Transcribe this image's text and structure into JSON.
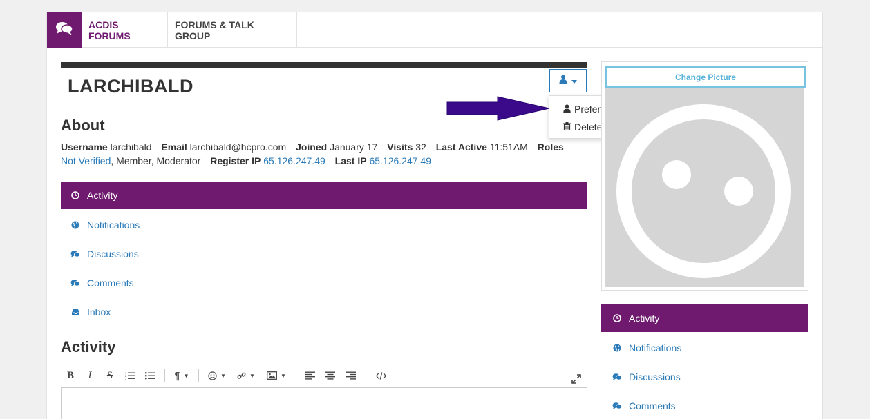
{
  "topnav": {
    "tabs": [
      {
        "label": "ACDIS FORUMS"
      },
      {
        "label": "FORUMS & TALK GROUP"
      }
    ]
  },
  "profile": {
    "username": "LARCHIBALD",
    "menu": {
      "items": [
        {
          "label": "Preferences",
          "icon": "user-icon"
        },
        {
          "label": "Delete Content",
          "icon": "trash-icon"
        }
      ]
    }
  },
  "about": {
    "heading": "About",
    "username_label": "Username",
    "username_value": "larchibald",
    "email_label": "Email",
    "email_value": "larchibald@hcpro.com",
    "joined_label": "Joined",
    "joined_value": "January 17",
    "visits_label": "Visits",
    "visits_value": "32",
    "last_active_label": "Last Active",
    "last_active_value": "11:51AM",
    "roles_label": "Roles",
    "roles_link": "Not Verified",
    "roles_rest": ", Member, Moderator",
    "register_ip_label": "Register IP",
    "register_ip_value": "65.126.247.49",
    "last_ip_label": "Last IP",
    "last_ip_value": "65.126.247.49"
  },
  "tabs": [
    {
      "label": "Activity",
      "icon": "clock-icon",
      "active": true
    },
    {
      "label": "Notifications",
      "icon": "globe-icon"
    },
    {
      "label": "Discussions",
      "icon": "comments-icon"
    },
    {
      "label": "Comments",
      "icon": "comments-icon"
    },
    {
      "label": "Inbox",
      "icon": "inbox-icon"
    }
  ],
  "activity": {
    "heading": "Activity"
  },
  "sidebar": {
    "change_picture": "Change Picture"
  },
  "colors": {
    "brand_purple": "#6f1a6f",
    "link_blue": "#2a7ab8",
    "accent_cyan": "#58b4d8",
    "annotation_arrow": "#3a0a8a"
  }
}
